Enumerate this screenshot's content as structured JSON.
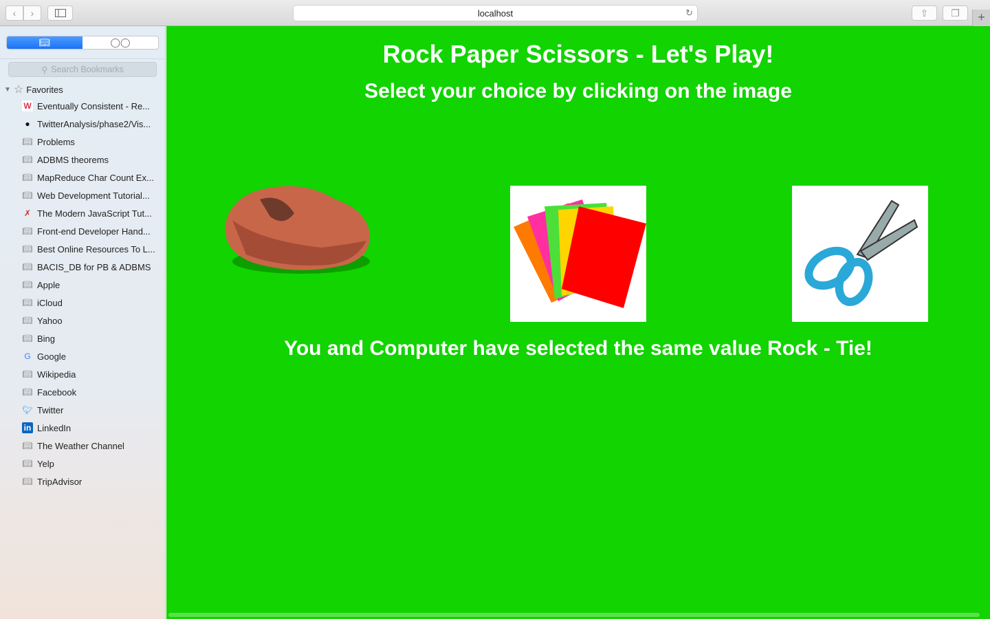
{
  "browser": {
    "url": "localhost",
    "back": "‹",
    "forward": "›",
    "new_tab": "+"
  },
  "sidebar": {
    "search_placeholder": "Search Bookmarks",
    "favorites_label": "Favorites",
    "items": [
      {
        "label": "Eventually Consistent - Re...",
        "icon": "w-favicon"
      },
      {
        "label": "TwitterAnalysis/phase2/Vis...",
        "icon": "github-icon"
      },
      {
        "label": "Problems",
        "icon": "book-icon"
      },
      {
        "label": "ADBMS theorems",
        "icon": "book-icon"
      },
      {
        "label": "MapReduce Char Count Ex...",
        "icon": "book-icon"
      },
      {
        "label": "Web Development Tutorial...",
        "icon": "book-icon"
      },
      {
        "label": "The Modern JavaScript Tut...",
        "icon": "js-tutorial-icon"
      },
      {
        "label": "Front-end Developer Hand...",
        "icon": "book-icon"
      },
      {
        "label": "Best Online Resources To L...",
        "icon": "book-icon"
      },
      {
        "label": "BACIS_DB for PB & ADBMS",
        "icon": "book-icon"
      },
      {
        "label": "Apple",
        "icon": "book-icon"
      },
      {
        "label": "iCloud",
        "icon": "book-icon"
      },
      {
        "label": "Yahoo",
        "icon": "book-icon"
      },
      {
        "label": "Bing",
        "icon": "book-icon"
      },
      {
        "label": "Google",
        "icon": "google-icon"
      },
      {
        "label": "Wikipedia",
        "icon": "book-icon"
      },
      {
        "label": "Facebook",
        "icon": "book-icon"
      },
      {
        "label": "Twitter",
        "icon": "twitter-icon"
      },
      {
        "label": "LinkedIn",
        "icon": "linkedin-icon"
      },
      {
        "label": "The Weather Channel",
        "icon": "book-icon"
      },
      {
        "label": "Yelp",
        "icon": "book-icon"
      },
      {
        "label": "TripAdvisor",
        "icon": "book-icon"
      }
    ]
  },
  "game": {
    "title": "Rock Paper Scissors - Let's Play!",
    "subtitle": "Select your choice by clicking on the image",
    "result": "You and Computer have selected the same value Rock - Tie!",
    "choices": [
      "rock",
      "paper",
      "scissors"
    ]
  },
  "colors": {
    "background": "#11d400",
    "accent": "#1a73f5"
  }
}
